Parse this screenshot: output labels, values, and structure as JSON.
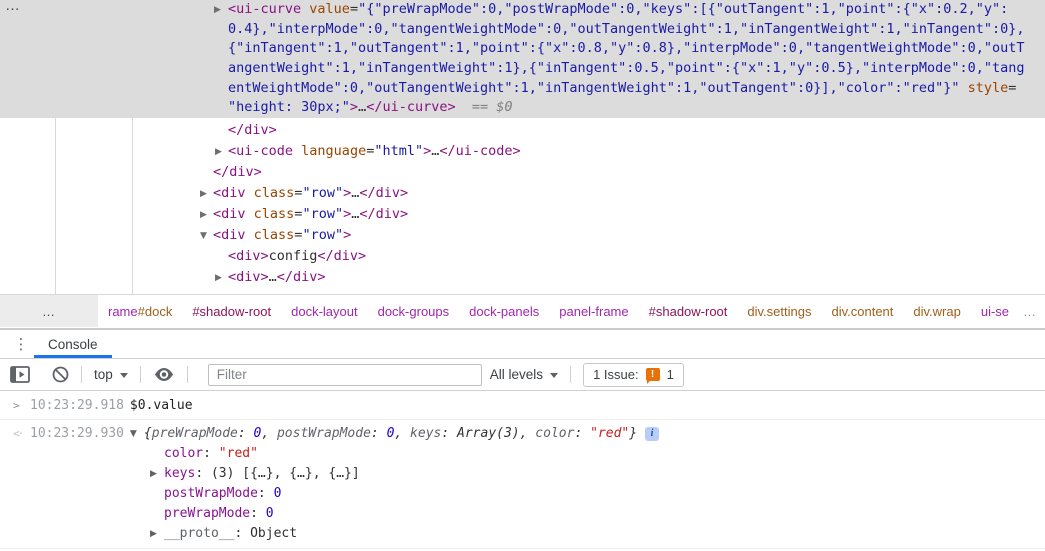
{
  "elements": {
    "overflow_dots": "…",
    "selected": {
      "lines": [
        [
          {
            "t": "▶",
            "c": "arrow"
          },
          {
            "t": "<ui-curve",
            "c": "tag"
          },
          {
            "t": " ",
            "c": "plain"
          },
          {
            "t": "value",
            "c": "attr"
          },
          {
            "t": "=",
            "c": "plain"
          },
          {
            "t": "\"{\"preWrapMode\":0,\"postWrapMode\":0,\"keys\":[{\"outTangent\":1,\"point\":{\"x\":0.2,\"y\":",
            "c": "val"
          }
        ],
        [
          {
            "t": "0.4},\"interpMode\":0,\"tangentWeightMode\":0,\"outTangentWeight\":1,\"inTangentWeight\":1,\"inTangent\":0},",
            "c": "val"
          }
        ],
        [
          {
            "t": "{\"inTangent\":1,\"outTangent\":1,\"point\":{\"x\":0.8,\"y\":0.8},\"interpMode\":0,\"tangentWeightMode\":0,\"outT",
            "c": "val"
          }
        ],
        [
          {
            "t": "angentWeight\":1,\"inTangentWeight\":1},{\"inTangent\":0.5,\"point\":{\"x\":1,\"y\":0.5},\"interpMode\":0,\"tang",
            "c": "val"
          }
        ],
        [
          {
            "t": "entWeightMode\":0,\"outTangentWeight\":1,\"inTangentWeight\":1,\"outTangent\":0}],\"color\":\"red\"}\"",
            "c": "val"
          },
          {
            "t": " ",
            "c": "plain"
          },
          {
            "t": "style",
            "c": "attr"
          },
          {
            "t": "=",
            "c": "plain"
          }
        ],
        [
          {
            "t": "\"height: 30px;\"",
            "c": "val"
          },
          {
            "t": ">",
            "c": "tag"
          },
          {
            "t": "…",
            "c": "plain"
          },
          {
            "t": "</ui-curve>",
            "c": "tag"
          },
          {
            "t": "  ",
            "c": "plain"
          },
          {
            "t": "== $0",
            "c": "eq"
          }
        ]
      ]
    },
    "tree": {
      "lines": [
        [
          {
            "t": "</div>",
            "c": "tag"
          }
        ],
        [
          {
            "t": "▶",
            "c": "arrow"
          },
          {
            "t": "<ui-code",
            "c": "tag"
          },
          {
            "t": " ",
            "c": "plain"
          },
          {
            "t": "language",
            "c": "attr"
          },
          {
            "t": "=",
            "c": "plain"
          },
          {
            "t": "\"html\"",
            "c": "val"
          },
          {
            "t": ">",
            "c": "tag"
          },
          {
            "t": "…",
            "c": "plain"
          },
          {
            "t": "</ui-code>",
            "c": "tag"
          }
        ],
        [
          {
            "t": "</div>",
            "c": "tag"
          }
        ],
        [
          {
            "t": "▶",
            "c": "arrow"
          },
          {
            "t": "<div",
            "c": "tag"
          },
          {
            "t": " ",
            "c": "plain"
          },
          {
            "t": "class",
            "c": "attr"
          },
          {
            "t": "=",
            "c": "plain"
          },
          {
            "t": "\"row\"",
            "c": "val"
          },
          {
            "t": ">",
            "c": "tag"
          },
          {
            "t": "…",
            "c": "plain"
          },
          {
            "t": "</div>",
            "c": "tag"
          }
        ],
        [
          {
            "t": "▶",
            "c": "arrow"
          },
          {
            "t": "<div",
            "c": "tag"
          },
          {
            "t": " ",
            "c": "plain"
          },
          {
            "t": "class",
            "c": "attr"
          },
          {
            "t": "=",
            "c": "plain"
          },
          {
            "t": "\"row\"",
            "c": "val"
          },
          {
            "t": ">",
            "c": "tag"
          },
          {
            "t": "…",
            "c": "plain"
          },
          {
            "t": "</div>",
            "c": "tag"
          }
        ],
        [
          {
            "t": "▼",
            "c": "arrow"
          },
          {
            "t": "<div",
            "c": "tag"
          },
          {
            "t": " ",
            "c": "plain"
          },
          {
            "t": "class",
            "c": "attr"
          },
          {
            "t": "=",
            "c": "plain"
          },
          {
            "t": "\"row\"",
            "c": "val"
          },
          {
            "t": ">",
            "c": "tag"
          }
        ],
        [
          {
            "t": "<div>",
            "c": "tag"
          },
          {
            "t": "config",
            "c": "plain"
          },
          {
            "t": "</div>",
            "c": "tag"
          }
        ],
        [
          {
            "t": "▶",
            "c": "arrow"
          },
          {
            "t": "<div>",
            "c": "tag"
          },
          {
            "t": "…",
            "c": "plain"
          },
          {
            "t": "</div>",
            "c": "tag"
          }
        ]
      ]
    }
  },
  "breadcrumbs": {
    "overflow": "…",
    "trailing": "…",
    "items": [
      {
        "parts": [
          {
            "t": "rame",
            "c": "ctag"
          },
          {
            "t": "#dock",
            "c": "cid"
          }
        ]
      },
      {
        "parts": [
          {
            "t": "#shadow-root",
            "c": "cshadow"
          }
        ]
      },
      {
        "parts": [
          {
            "t": "dock-layout",
            "c": "ctag"
          }
        ]
      },
      {
        "parts": [
          {
            "t": "dock-groups",
            "c": "ctag"
          }
        ]
      },
      {
        "parts": [
          {
            "t": "dock-panels",
            "c": "ctag"
          }
        ]
      },
      {
        "parts": [
          {
            "t": "panel-frame",
            "c": "ctag"
          }
        ]
      },
      {
        "parts": [
          {
            "t": "#shadow-root",
            "c": "cshadow"
          }
        ]
      },
      {
        "parts": [
          {
            "t": "div.settings",
            "c": "cid"
          }
        ]
      },
      {
        "parts": [
          {
            "t": "div.content",
            "c": "cid"
          }
        ]
      },
      {
        "parts": [
          {
            "t": "div.wrap",
            "c": "cid"
          }
        ]
      },
      {
        "parts": [
          {
            "t": "ui-se",
            "c": "ctag"
          }
        ]
      }
    ]
  },
  "console": {
    "menu_icon": "⋮",
    "tab_label": "Console",
    "context": "top",
    "filter_placeholder": "Filter",
    "levels_label": "All levels",
    "issues": {
      "label": "1 Issue:",
      "badge": "!",
      "count": "1"
    },
    "icons": [
      "console-sidebar-icon",
      "clear-console-icon",
      "eye-icon",
      "dropdown-arrow-icon",
      "issue-badge-icon",
      "info-icon"
    ],
    "rows": {
      "input": {
        "chevron": ">",
        "time": "10:23:29.918",
        "text": "$0.value"
      },
      "output": {
        "marker": "<·",
        "time": "10:23:29.930",
        "arrow": "▼",
        "preview": [
          {
            "t": "{",
            "c": "pv"
          },
          {
            "t": "preWrapMode",
            "c": "pvname"
          },
          {
            "t": ": ",
            "c": "pv"
          },
          {
            "t": "0",
            "c": "num"
          },
          {
            "t": ", ",
            "c": "pv"
          },
          {
            "t": "postWrapMode",
            "c": "pvname"
          },
          {
            "t": ": ",
            "c": "pv"
          },
          {
            "t": "0",
            "c": "num"
          },
          {
            "t": ", ",
            "c": "pv"
          },
          {
            "t": "keys",
            "c": "pvname"
          },
          {
            "t": ": ",
            "c": "pv"
          },
          {
            "t": "Array(3)",
            "c": "pv"
          },
          {
            "t": ", ",
            "c": "pv"
          },
          {
            "t": "color",
            "c": "pvname"
          },
          {
            "t": ": ",
            "c": "pv"
          },
          {
            "t": "\"red\"",
            "c": "str"
          },
          {
            "t": "}",
            "c": "pv"
          }
        ],
        "info_icon": "i",
        "props": [
          {
            "arrow": "",
            "segs": [
              {
                "t": "color",
                "c": "prop"
              },
              {
                "t": ": ",
                "c": "plain"
              },
              {
                "t": "\"red\"",
                "c": "str"
              }
            ]
          },
          {
            "arrow": "▶",
            "segs": [
              {
                "t": "keys",
                "c": "prop"
              },
              {
                "t": ": ",
                "c": "plain"
              },
              {
                "t": "(3) [{…}, {…}, {…}]",
                "c": "plain"
              }
            ]
          },
          {
            "arrow": "",
            "segs": [
              {
                "t": "postWrapMode",
                "c": "prop"
              },
              {
                "t": ": ",
                "c": "plain"
              },
              {
                "t": "0",
                "c": "num"
              }
            ]
          },
          {
            "arrow": "",
            "segs": [
              {
                "t": "preWrapMode",
                "c": "prop"
              },
              {
                "t": ": ",
                "c": "plain"
              },
              {
                "t": "0",
                "c": "num"
              }
            ]
          },
          {
            "arrow": "▶",
            "segs": [
              {
                "t": "__proto__",
                "c": "dim2"
              },
              {
                "t": ": ",
                "c": "plain"
              },
              {
                "t": "Object",
                "c": "plain"
              }
            ]
          }
        ]
      }
    }
  },
  "colors": {
    "tab_accent": "#1a73e8",
    "issue_orange": "#e8710a",
    "selection_gray": "#dcdcdc",
    "tag_purple": "#881280",
    "attr_orange": "#994500",
    "value_blue": "#1a1aa6",
    "string_red": "#c5221f",
    "number_blue": "#1c00cf"
  }
}
